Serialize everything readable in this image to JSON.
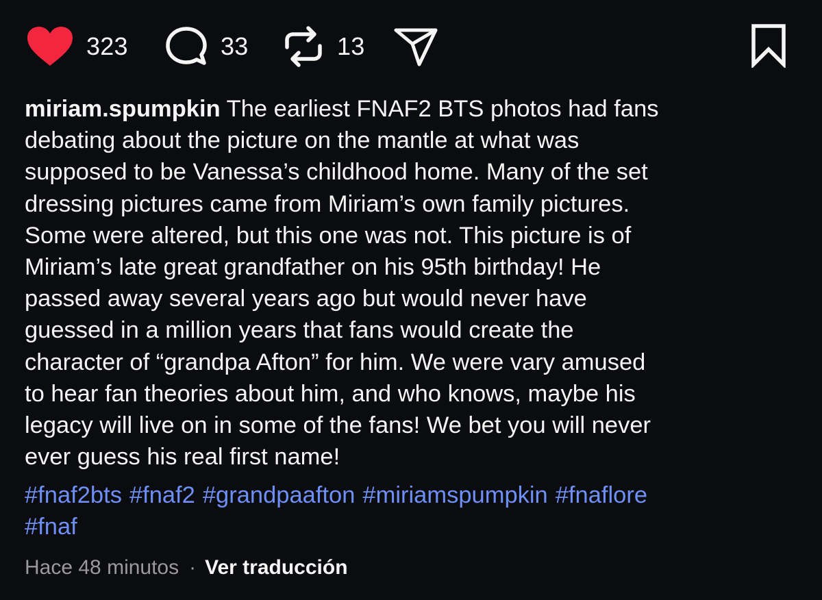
{
  "actions": {
    "likes": "323",
    "comments": "33",
    "reposts": "13"
  },
  "colors": {
    "like_active": "#f2263f",
    "hashtag": "#6e8ff5"
  },
  "icons": {
    "like": "heart-icon",
    "comment": "speech-bubble-icon",
    "repost": "repost-icon",
    "share": "paper-plane-icon",
    "save": "bookmark-icon"
  },
  "post": {
    "username": "miriam.spumpkin",
    "caption_lines": [
      " The earliest FNAF2 BTS photos had fans",
      "debating about the picture on the mantle at what was",
      "supposed to be Vanessa’s childhood home.  Many of the set",
      "dressing pictures came from Miriam’s own family pictures.",
      "Some were altered, but this one was not.  This picture is of",
      "Miriam’s late great grandfather on his 95th birthday!  He",
      "passed away several years ago but would never have",
      "guessed in a million years that fans would create the",
      "character of “grandpa Afton” for him.  We were vary amused",
      "to hear fan theories about him, and who knows, maybe his",
      "legacy will live on in some of the fans!  We bet you will never",
      "ever guess his real first name!"
    ],
    "hashtags": [
      "#fnaf2bts",
      "#fnaf2",
      "#grandpaafton",
      "#miriamspumpkin",
      "#fnaflore",
      "#fnaf"
    ],
    "timestamp": "Hace 48 minutos",
    "separator": "·",
    "translate_label": "Ver traducción"
  }
}
